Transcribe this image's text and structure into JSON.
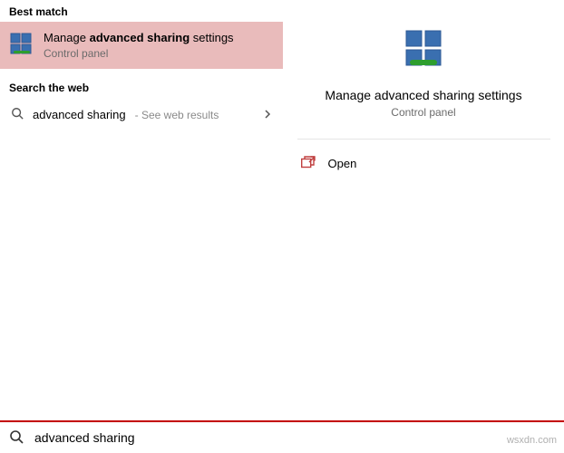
{
  "left": {
    "best_match_header": "Best match",
    "best_match": {
      "title_prefix": "Manage ",
      "title_bold": "advanced sharing",
      "title_suffix": " settings",
      "subtitle": "Control panel"
    },
    "web_header": "Search the web",
    "web": {
      "query": "advanced sharing",
      "hint": " - See web results"
    }
  },
  "right": {
    "title": "Manage advanced sharing settings",
    "subtitle": "Control panel",
    "actions": {
      "open": "Open"
    }
  },
  "search": {
    "value": "advanced sharing"
  },
  "watermark": "wsxdn.com"
}
